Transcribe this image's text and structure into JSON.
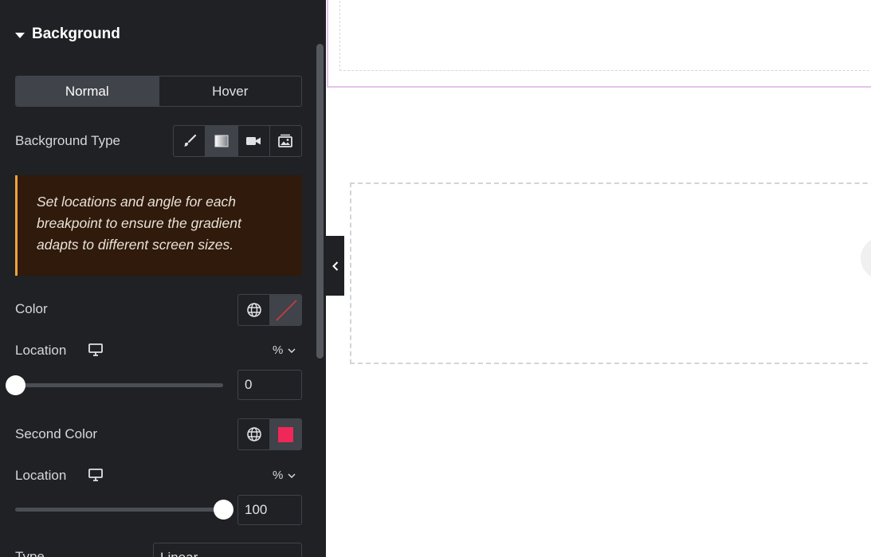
{
  "panel": {
    "section_title": "Background",
    "tabs": [
      {
        "label": "Normal",
        "active": true
      },
      {
        "label": "Hover",
        "active": false
      }
    ],
    "background_type": {
      "label": "Background Type",
      "options": [
        {
          "icon": "brush-icon",
          "active": false
        },
        {
          "icon": "gradient-icon",
          "active": true
        },
        {
          "icon": "video-icon",
          "active": false
        },
        {
          "icon": "slideshow-icon",
          "active": false
        }
      ]
    },
    "notice": "Set locations and angle for each breakpoint to ensure the gradient adapts to different screen sizes.",
    "color": {
      "label": "Color",
      "value": "none"
    },
    "location1": {
      "label": "Location",
      "unit": "%",
      "value": "0",
      "fraction": 0
    },
    "second_color": {
      "label": "Second Color",
      "value": "#f0285a"
    },
    "location2": {
      "label": "Location",
      "unit": "%",
      "value": "100",
      "fraction": 1
    },
    "type": {
      "label": "Type",
      "value": "Linear"
    }
  },
  "colors": {
    "panel_bg": "#1f2124",
    "accent_notice": "#f0a33a",
    "second_color_swatch": "#f0285a",
    "canvas_selected_border": "#e6c3ea"
  }
}
